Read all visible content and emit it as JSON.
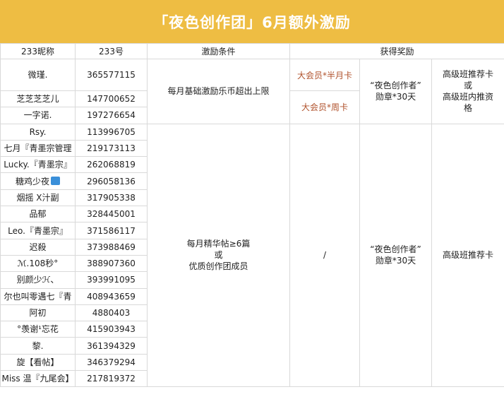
{
  "title": "「夜色创作团」6月额外激励",
  "headers": {
    "nickname": "233昵称",
    "uid": "233号",
    "condition": "激励条件",
    "reward": "获得奖励"
  },
  "rows": [
    {
      "nick": "微瑾.",
      "uid": "365577115"
    },
    {
      "nick": "芝芝芝芝儿",
      "uid": "147700652"
    },
    {
      "nick": "一字诺.",
      "uid": "197276654"
    },
    {
      "nick": "Rsy.",
      "uid": "113996705"
    },
    {
      "nick": "七月『青墨宗管理",
      "uid": "219173113"
    },
    {
      "nick": "Lucky.『青墨宗』",
      "uid": "262068819"
    },
    {
      "nick": "糖鸡少夜",
      "uid": "296058136"
    },
    {
      "nick": "烟摇 X汁副",
      "uid": "317905338"
    },
    {
      "nick": "品郁",
      "uid": "328445001"
    },
    {
      "nick": "Leo.『青墨宗』",
      "uid": "371586117"
    },
    {
      "nick": "迟殺",
      "uid": "373988469"
    },
    {
      "nick": "ℳ.108秒°",
      "uid": "388907360"
    },
    {
      "nick": "别颜少ℋ、",
      "uid": "393991095"
    },
    {
      "nick": "尔也叫零遇七『青",
      "uid": "408943659"
    },
    {
      "nick": "阿初",
      "uid": "4880403"
    },
    {
      "nick": "°羡谢¹忘花",
      "uid": "415903943"
    },
    {
      "nick": "黎.",
      "uid": "361394329"
    },
    {
      "nick": "旋【看帖】",
      "uid": "346379294"
    },
    {
      "nick": "Miss 温『九尾会】",
      "uid": "217819372"
    }
  ],
  "group1": {
    "condition": "每月基础激励乐币超出上限",
    "reward_a1": "大会员*半月卡",
    "reward_a2": "大会员*周卡",
    "reward_b_line1": "“夜色创作者”",
    "reward_b_line2": "勋章*30天",
    "reward_c_line1": "高级班推荐卡",
    "reward_c_line2": "或",
    "reward_c_line3": "高级班内推资",
    "reward_c_line4": "格"
  },
  "group2": {
    "condition_line1": "每月精华帖≥6篇",
    "condition_line2": "或",
    "condition_line3": "优质创作团成员",
    "reward_a": "/",
    "reward_b_line1": "“夜色创作者”",
    "reward_b_line2": "勋章*30天",
    "reward_c": "高级班推荐卡"
  },
  "colors": {
    "title_bg": "#eebd43",
    "title_text": "#ffffff",
    "reward_red": "#b0522c",
    "grid": "#d9d9d9"
  }
}
